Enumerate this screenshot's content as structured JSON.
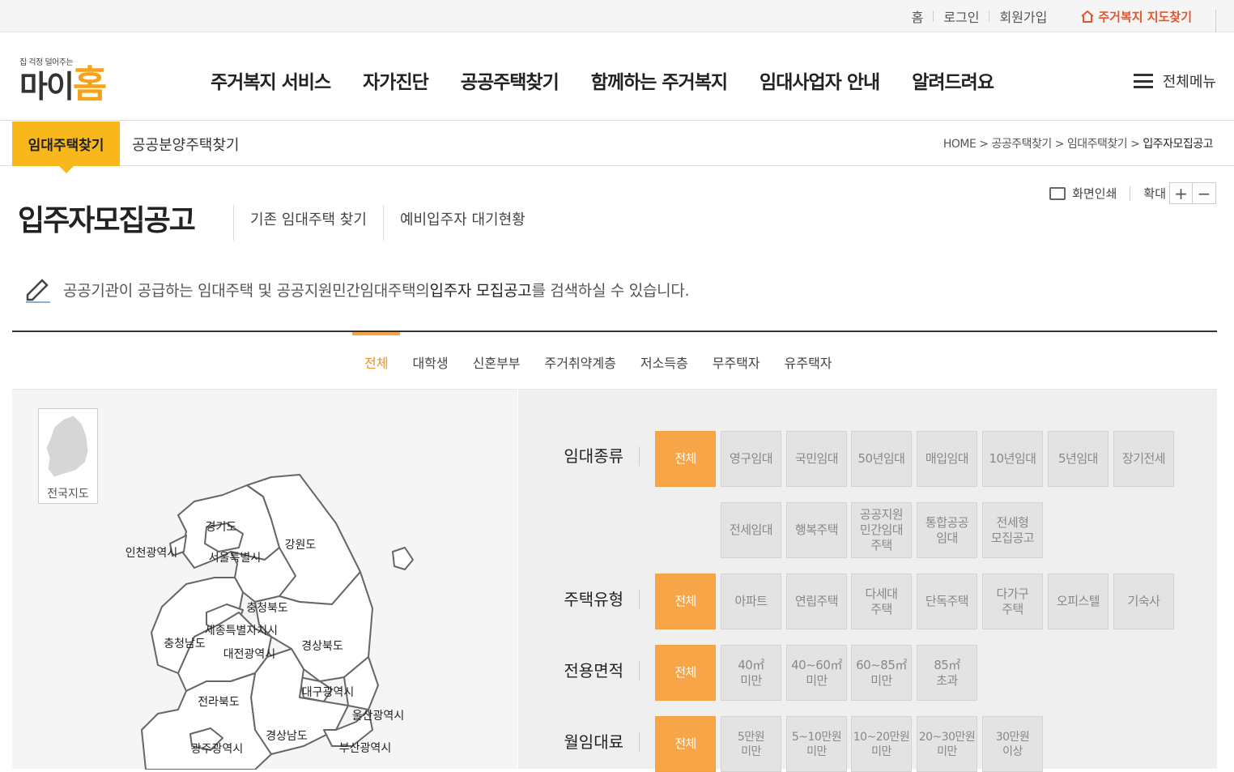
{
  "util": {
    "home": "홈",
    "login": "로그인",
    "join": "회원가입",
    "map_link": "주거복지 지도찾기"
  },
  "logo": {
    "tagline": "집 걱정 덜어주는",
    "name_a": "마이",
    "name_b": "홈"
  },
  "gnb": [
    "주거복지 서비스",
    "자가진단",
    "공공주택찾기",
    "함께하는 주거복지",
    "임대사업자 안내",
    "알려드려요"
  ],
  "all_menu": "전체메뉴",
  "subnav": {
    "active": "임대주택찾기",
    "other": "공공분양주택찾기"
  },
  "breadcrumb": [
    "HOME",
    "공공주택찾기",
    "임대주택찾기",
    "입주자모집공고"
  ],
  "page": {
    "title": "입주자모집공고",
    "link1": "기존 임대주택 찾기",
    "link2": "예비입주자 대기현황",
    "print": "화면인쇄",
    "zoom": "확대",
    "zoom_in": "+",
    "zoom_out": "−",
    "desc_a": "공공기관이 공급하는 임대주택 및 공공지원민간임대주택의 ",
    "desc_hl": "입주자 모집공고",
    "desc_b": "를 검색하실 수 있습니다."
  },
  "categories": [
    "전체",
    "대학생",
    "신혼부부",
    "주거취약계층",
    "저소득층",
    "무주택자",
    "유주택자"
  ],
  "map": {
    "thumb_label": "전국지도",
    "regions": [
      "경기도",
      "인천광역시",
      "서울특별시",
      "강원도",
      "충청북도",
      "세종특별자치시",
      "충청남도",
      "대전광역시",
      "경상북도",
      "대구광역시",
      "전라북도",
      "울산광역시",
      "경상남도",
      "광주광역시",
      "부산광역시"
    ]
  },
  "filters": {
    "rent_type": {
      "label": "임대종류",
      "options": [
        "전체",
        "영구임대",
        "국민임대",
        "50년임대",
        "매입임대",
        "10년임대",
        "5년임대",
        "장기전세",
        "전세임대",
        "행복주택",
        "공공지원\n민간임대\n주택",
        "통합공공\n임대",
        "전세형\n모집공고"
      ]
    },
    "house_type": {
      "label": "주택유형",
      "options": [
        "전체",
        "아파트",
        "연립주택",
        "다세대\n주택",
        "단독주택",
        "다가구\n주택",
        "오피스텔",
        "기숙사"
      ]
    },
    "area": {
      "label": "전용면적",
      "options": [
        "전체",
        "40㎡\n미만",
        "40~60㎡\n미만",
        "60~85㎡\n미만",
        "85㎡\n초과"
      ]
    },
    "rent": {
      "label": "월임대료",
      "options": [
        "전체",
        "5만원\n미만",
        "5~10만원\n미만",
        "10~20만원\n미만",
        "20~30만원\n미만",
        "30만원\n이상"
      ]
    }
  },
  "colors": {
    "accent": "#f8b81b",
    "option_on": "#f8a548",
    "map_link": "#e8542b"
  }
}
